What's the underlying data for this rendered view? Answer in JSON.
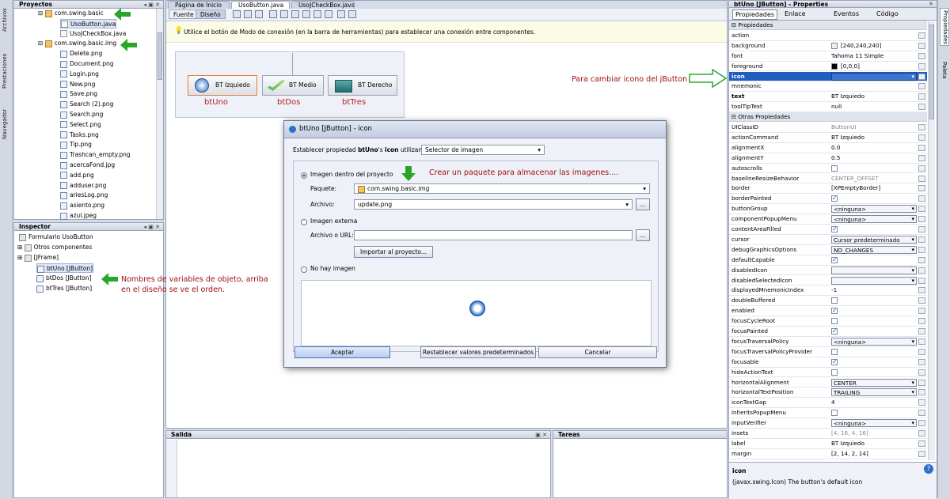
{
  "side_tabs": [
    "Archivos",
    "Prestaciones",
    "Navegador"
  ],
  "right_side_tabs": [
    "Propiedades",
    "Paleta"
  ],
  "projects": {
    "title": "Proyectos",
    "items": [
      "com.swing.basic",
      "UsoButton.java",
      "UsoJCheckBox.java",
      "com.swing.basic.img",
      "Delete.png",
      "Document.png",
      "Login.png",
      "New.png",
      "Save.png",
      "Search (2).png",
      "Search.png",
      "Select.png",
      "Tasks.png",
      "Tip.png",
      "Trashcan_empty.png",
      "acercaFond.jpg",
      "add.png",
      "adduser.png",
      "ariesLog.png",
      "asiento.png",
      "azul.jpeg"
    ]
  },
  "inspector": {
    "title": "Inspector",
    "items": [
      "Formulario UsoButton",
      "Otros componentes",
      "[JFrame]",
      "btUno [JButton]",
      "btDos [JButton]",
      "btTres [JButton]"
    ]
  },
  "editor": {
    "tabs": [
      "Página de Inicio",
      "UsoButton.java",
      "UsoJCheckBox.java"
    ],
    "fuente": "Fuente",
    "diseno": "Diseño",
    "hint": "Utilice el botón de Modo de conexión (en la barra de herramientas) para establecer una conexión entre componentes.",
    "buttons": [
      {
        "label": "BT Izquiedo",
        "var": "btUno"
      },
      {
        "label": "BT Medio",
        "var": "btDos"
      },
      {
        "label": "BT Derecho",
        "var": "btTres"
      }
    ]
  },
  "annotations": {
    "icon_note": "Para cambiar icono del jButton",
    "inspector_note_1": "Nombres de variables de objeto, arriba",
    "inspector_note_2": "en el diseño se ve el orden.",
    "package_note": "Crear un paquete para almacenar las imagenes...."
  },
  "dialog": {
    "title": "btUno [JButton] - icon",
    "set_prefix": "Establecer propiedad",
    "set_bold_1": "btUno",
    "set_mid": "'s",
    "set_bold_2": "icon",
    "set_suffix": "utilizando:",
    "selector": "Selector de imagen",
    "opt_project": "Imagen dentro del proyecto",
    "paquete_label": "Paquete:",
    "paquete_value": "com.swing.basic.img",
    "archivo_label": "Archivo:",
    "archivo_value": "update.png",
    "browse": "...",
    "opt_external": "Imagen externa",
    "url_label": "Archivo o URL:",
    "import_btn": "Importar al proyecto...",
    "opt_none": "No hay imagen",
    "accept": "Aceptar",
    "reset": "Restablecer valores predeterminados",
    "cancel": "Cancelar"
  },
  "bottom": {
    "salida": "Salida",
    "tareas": "Tareas"
  },
  "properties": {
    "title": "btUno [JButton] - Properties",
    "tabs": [
      "Propiedades",
      "Enlace",
      "Eventos",
      "Código"
    ],
    "group1": "Propiedades",
    "group2": "Otras Propiedades",
    "rows1": [
      {
        "name": "action",
        "value": ""
      },
      {
        "name": "background",
        "value": "[240,240,240]"
      },
      {
        "name": "font",
        "value": "Tahoma 11 Simple"
      },
      {
        "name": "foreground",
        "value": "[0,0,0]"
      },
      {
        "name": "icon",
        "value": ""
      },
      {
        "name": "mnemonic",
        "value": ""
      },
      {
        "name": "text",
        "value": "BT Izquiedo"
      },
      {
        "name": "toolTipText",
        "value": "null"
      }
    ],
    "rows2": [
      {
        "name": "UIClassID",
        "value": "ButtonUI"
      },
      {
        "name": "actionCommand",
        "value": "BT Izquiedo"
      },
      {
        "name": "alignmentX",
        "value": "0.0"
      },
      {
        "name": "alignmentY",
        "value": "0.5"
      },
      {
        "name": "autoscrolls",
        "value": "[ ]"
      },
      {
        "name": "baselineResizeBehavior",
        "value": "CENTER_OFFSET"
      },
      {
        "name": "border",
        "value": "[XPEmptyBorder]"
      },
      {
        "name": "borderPainted",
        "value": "[x]"
      },
      {
        "name": "buttonGroup",
        "value": "<ninguna>"
      },
      {
        "name": "componentPopupMenu",
        "value": "<ninguna>"
      },
      {
        "name": "contentAreaFilled",
        "value": "[x]"
      },
      {
        "name": "cursor",
        "value": "Cursor predeterminado"
      },
      {
        "name": "debugGraphicsOptions",
        "value": "NO_CHANGES"
      },
      {
        "name": "defaultCapable",
        "value": "[x]"
      },
      {
        "name": "disabledIcon",
        "value": ""
      },
      {
        "name": "disabledSelectedIcon",
        "value": ""
      },
      {
        "name": "displayedMnemonicIndex",
        "value": "-1"
      },
      {
        "name": "doubleBuffered",
        "value": "[ ]"
      },
      {
        "name": "enabled",
        "value": "[x]"
      },
      {
        "name": "focusCycleRoot",
        "value": "[ ]"
      },
      {
        "name": "focusPainted",
        "value": "[x]"
      },
      {
        "name": "focusTraversalPolicy",
        "value": "<ninguna>"
      },
      {
        "name": "focusTraversalPolicyProvider",
        "value": "[ ]"
      },
      {
        "name": "focusable",
        "value": "[x]"
      },
      {
        "name": "hideActionText",
        "value": "[ ]"
      },
      {
        "name": "horizontalAlignment",
        "value": "CENTER"
      },
      {
        "name": "horizontalTextPosition",
        "value": "TRAILING"
      },
      {
        "name": "iconTextGap",
        "value": "4"
      },
      {
        "name": "inheritsPopupMenu",
        "value": "[ ]"
      },
      {
        "name": "inputVerifier",
        "value": "<ninguna>"
      },
      {
        "name": "insets",
        "value": "[4, 16, 4, 16]"
      },
      {
        "name": "label",
        "value": "BT Izquiedo"
      },
      {
        "name": "margin",
        "value": "[2, 14, 2, 14]"
      }
    ],
    "dropdown_names": [
      "buttonGroup",
      "componentPopupMenu",
      "cursor",
      "debugGraphicsOptions",
      "disabledIcon",
      "disabledSelectedIcon",
      "focusTraversalPolicy",
      "horizontalAlignment",
      "horizontalTextPosition",
      "inputVerifier",
      "icon"
    ],
    "footer_title": "icon",
    "footer_desc": "(javax.swing.Icon) The button's default icon"
  },
  "colors": {
    "selection": "#1f5dbf",
    "arrow_green": "#2aa52a",
    "note_red": "#b22222"
  }
}
